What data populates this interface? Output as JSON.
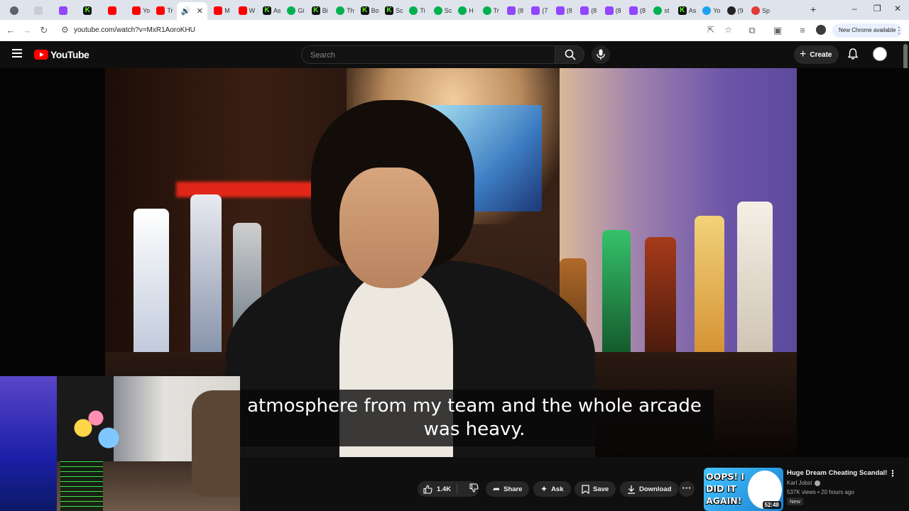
{
  "browser": {
    "tabs": [
      {
        "title": "",
        "icon": "chrome-icon"
      },
      {
        "title": "",
        "icon": "blank-icon"
      },
      {
        "title": "",
        "icon": "twitch-icon"
      },
      {
        "title": "",
        "icon": "kick-icon"
      },
      {
        "title": "",
        "icon": "youtube-icon"
      },
      {
        "title": "Yo",
        "icon": "youtube-icon"
      },
      {
        "title": "Tr",
        "icon": "youtube-icon"
      },
      {
        "title": "",
        "icon": "sound-icon",
        "active": true
      },
      {
        "title": "M",
        "icon": "youtube-icon"
      },
      {
        "title": "W",
        "icon": "youtube-icon"
      },
      {
        "title": "As",
        "icon": "kick-icon"
      },
      {
        "title": "Gi",
        "icon": "gx-icon"
      },
      {
        "title": "Bi",
        "icon": "kick-icon"
      },
      {
        "title": "Th",
        "icon": "gx-icon"
      },
      {
        "title": "Bo",
        "icon": "kick-icon"
      },
      {
        "title": "Sc",
        "icon": "kick-icon"
      },
      {
        "title": "Ti",
        "icon": "gx-icon"
      },
      {
        "title": "Sc",
        "icon": "gx-icon"
      },
      {
        "title": "H",
        "icon": "gx-icon"
      },
      {
        "title": "Tr",
        "icon": "gx-icon"
      },
      {
        "title": "(8",
        "icon": "twitch-icon"
      },
      {
        "title": "(7",
        "icon": "twitch-icon"
      },
      {
        "title": "(8",
        "icon": "twitch-icon"
      },
      {
        "title": "(8",
        "icon": "twitch-icon"
      },
      {
        "title": "(8",
        "icon": "twitch-icon"
      },
      {
        "title": "(8",
        "icon": "twitch-icon"
      },
      {
        "title": "st",
        "icon": "gx-icon"
      },
      {
        "title": "As",
        "icon": "kick-icon"
      },
      {
        "title": "Yo",
        "icon": "blue-icon"
      },
      {
        "title": "(9",
        "icon": "dark-icon"
      },
      {
        "title": "Sp",
        "icon": "red-icon"
      }
    ],
    "url": "youtube.com/watch?v=MxR1AoroKHU",
    "new_chrome_label": "New Chrome available"
  },
  "youtube": {
    "logo_text": "YouTube",
    "search_placeholder": "Search",
    "create_label": "Create"
  },
  "video": {
    "caption_line1": "atmosphere from my team and the whole arcade",
    "caption_line2": "was heavy."
  },
  "actions": {
    "like_count": "1.4K",
    "share_label": "Share",
    "ask_label": "Ask",
    "save_label": "Save",
    "download_label": "Download"
  },
  "recommended": {
    "title": "Huge Dream Cheating Scandal!",
    "channel": "Karl Jobst",
    "meta": "537K views • 20 hours ago",
    "badge": "New",
    "duration": "52:48",
    "thumb_text_1": "OOPS! I",
    "thumb_text_2": "DID IT",
    "thumb_text_3": "AGAIN!"
  },
  "colors": {
    "yt_red": "#ff0000",
    "bg": "#0f0f0f",
    "pill": "#272727"
  }
}
